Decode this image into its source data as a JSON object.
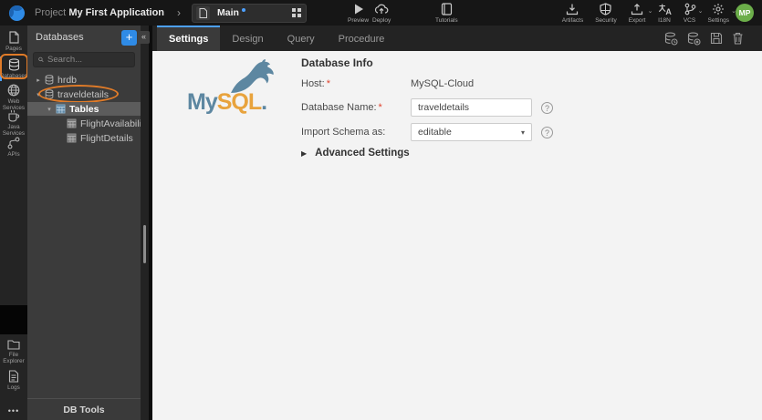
{
  "topbar": {
    "project_label": "Project",
    "project_name": "My First Application",
    "crumb_chevron": "›",
    "page_tab": {
      "label": "Main"
    },
    "actions_left": [
      {
        "label": "Preview",
        "icon": "play-icon"
      },
      {
        "label": "Deploy",
        "icon": "cloud-up-icon"
      },
      {
        "label": "Tutorials",
        "icon": "book-icon"
      }
    ],
    "actions_right": [
      {
        "label": "Artifacts",
        "icon": "download-tray-icon"
      },
      {
        "label": "Security",
        "icon": "shield-icon"
      },
      {
        "label": "Export",
        "icon": "upload-tray-icon",
        "caret": "⌄"
      },
      {
        "label": "I18N",
        "icon": "translate-icon"
      },
      {
        "label": "VCS",
        "icon": "branch-icon",
        "caret": "⌄"
      },
      {
        "label": "Settings",
        "icon": "gear-icon",
        "caret": "⌄"
      }
    ],
    "avatar_initials": "MP"
  },
  "sidebar": {
    "items_top": [
      {
        "label": "Pages",
        "icon": "page-icon"
      },
      {
        "label": "Databases",
        "icon": "database-icon",
        "active": true,
        "annotated": true
      },
      {
        "label": "Web Services",
        "icon": "globe-icon"
      },
      {
        "label": "Java Services",
        "icon": "coffee-icon"
      },
      {
        "label": "APIs",
        "icon": "api-nodes-icon"
      }
    ],
    "items_bottom": [
      {
        "label": "File Explorer",
        "icon": "folder-icon"
      },
      {
        "label": "Logs",
        "icon": "log-file-icon"
      }
    ],
    "more": "•••"
  },
  "panel": {
    "title": "Databases",
    "add_button": "+",
    "collapse_button": "«",
    "search_placeholder": "Search...",
    "tree": [
      {
        "label": "hrdb",
        "type": "database",
        "expanded": false
      },
      {
        "label": "traveldetails",
        "type": "database",
        "expanded": true,
        "annotated": true
      },
      {
        "label": "Tables",
        "type": "tables-group",
        "expanded": true,
        "selected": true
      },
      {
        "label": "FlightAvailability",
        "type": "table"
      },
      {
        "label": "FlightDetails",
        "type": "table"
      }
    ],
    "expanders": {
      "collapsed": "▸",
      "expanded": "▾"
    },
    "footer": "DB Tools"
  },
  "main": {
    "tabs": [
      {
        "label": "Settings",
        "active": true
      },
      {
        "label": "Design"
      },
      {
        "label": "Query"
      },
      {
        "label": "Procedure"
      }
    ],
    "toolbar_icons": [
      "db-sync-icon",
      "db-shell-icon",
      "save-icon",
      "delete-icon"
    ],
    "logo": {
      "text_my": "My",
      "text_sql": "SQL",
      "text_dot": "."
    },
    "form": {
      "heading": "Database Info",
      "host_label": "Host:",
      "host_value": "MySQL-Cloud",
      "dbname_label": "Database Name:",
      "dbname_value": "traveldetails",
      "schema_label": "Import Schema as:",
      "schema_value": "editable",
      "select_caret": "▾",
      "advanced_label": "Advanced Settings",
      "advanced_arrow": "▶",
      "required_marker": "*",
      "help_glyph": "?"
    }
  },
  "colors": {
    "accent_blue": "#4da1ff",
    "annotation_orange": "#e07b28",
    "avatar_green": "#6cae4a",
    "mysql_blue": "#5d87a1",
    "mysql_orange": "#e8a33d",
    "add_button_blue": "#2f8be6"
  }
}
